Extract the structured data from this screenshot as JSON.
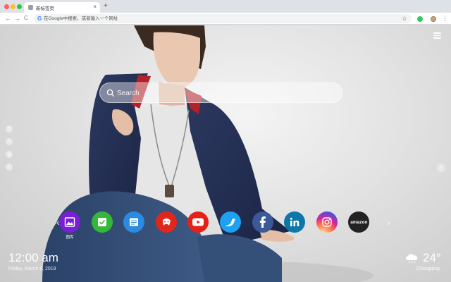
{
  "browser": {
    "tab_title": "新标签页",
    "tab_close": "×",
    "new_tab": "+",
    "omnibox_placeholder": "在Google中搜索，或者输入一个网址",
    "back": "←",
    "forward": "→",
    "reload": "C",
    "google_icon": "G",
    "bookmark": "☆",
    "menu": "⋮"
  },
  "search": {
    "placeholder": "Search"
  },
  "social": [
    "f",
    "t",
    "g",
    "r"
  ],
  "side_arrow": "‹",
  "dock": {
    "prev": "‹",
    "next": "›",
    "apps": [
      {
        "name": "gallery",
        "label": "图库",
        "color": "#7a1fd8",
        "icon": "gallery-icon"
      },
      {
        "name": "checkmark",
        "label": "",
        "color": "#35b83a",
        "icon": "check-icon"
      },
      {
        "name": "notes",
        "label": "",
        "color": "#2c8be0",
        "icon": "document-icon"
      },
      {
        "name": "game",
        "label": "",
        "color": "#e0271c",
        "icon": "gamepad-icon"
      },
      {
        "name": "youtube",
        "label": "",
        "color": "#e62117",
        "icon": "youtube-icon"
      },
      {
        "name": "twitter",
        "label": "",
        "color": "#1da1f2",
        "icon": "twitter-icon"
      },
      {
        "name": "facebook",
        "label": "",
        "color": "#3b5998",
        "icon": "facebook-icon"
      },
      {
        "name": "linkedin",
        "label": "",
        "color": "#0e76a8",
        "icon": "linkedin-icon"
      },
      {
        "name": "instagram",
        "label": "",
        "color": "#d6249f",
        "icon": "instagram-icon"
      },
      {
        "name": "amazon",
        "label": "",
        "color": "#222222",
        "icon": "amazon-icon",
        "text": "amazon"
      }
    ]
  },
  "clock": {
    "time": "12:00 am",
    "date": "Friday, March 8, 2019"
  },
  "weather": {
    "temp": "24°",
    "city": "Chongqing",
    "icon": "cloud-rain-icon"
  }
}
